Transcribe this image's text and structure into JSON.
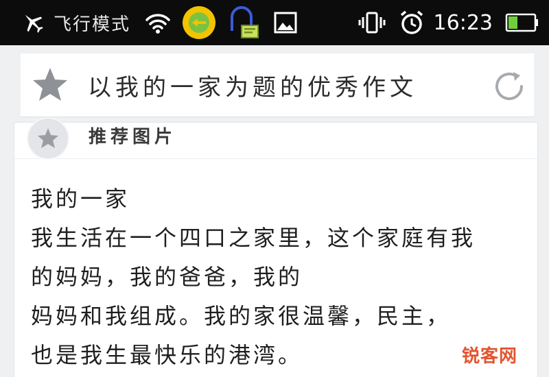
{
  "status_bar": {
    "airplane_mode_label": "飞行模式",
    "time": "16:23",
    "battery_color": "#6fcf3a"
  },
  "search": {
    "title": "以我的一家为题的优秀作文"
  },
  "post": {
    "author": "推荐图片",
    "lines": [
      "我的一家",
      "我生活在一个四口之家里，这个家庭有我",
      "的妈妈，我的爸爸，我的",
      "妈妈和我组成。我的家很温馨，民主，",
      "也是我生最快乐的港湾。"
    ]
  },
  "watermark": {
    "text": "锐客网"
  },
  "colors": {
    "status_bar_bg": "#0c0c0c",
    "page_bg": "#eef0f2",
    "watermark": "#e3542f",
    "notify_accent": "#3b5bdb",
    "badge_yellow": "#f2c300"
  },
  "icons": {
    "airplane": "airplane-icon",
    "wifi": "wifi-icon",
    "app_badge": "app-badge-icon",
    "notification": "notification-icon",
    "gallery": "gallery-icon",
    "vibrate": "vibrate-icon",
    "alarm": "alarm-icon",
    "battery": "battery-icon",
    "favorite": "star-icon",
    "refresh": "refresh-icon"
  }
}
